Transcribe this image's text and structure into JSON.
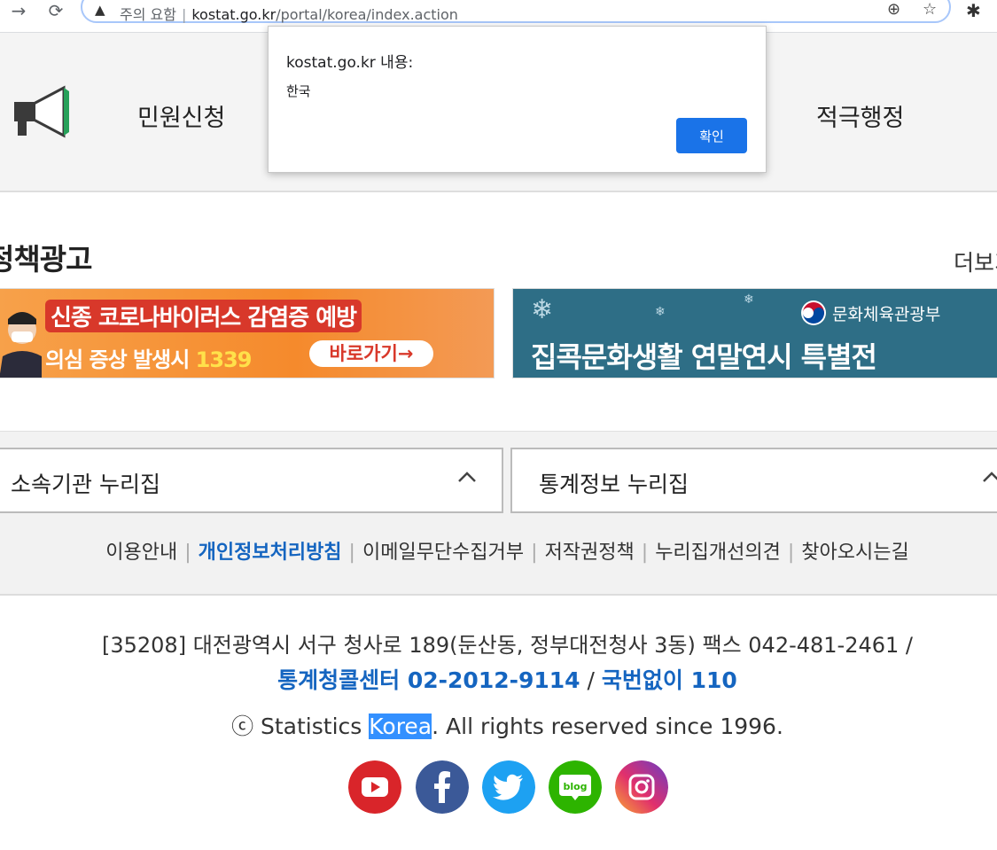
{
  "browser": {
    "security_label": "주의 요함",
    "url_host": "kostat.go.kr",
    "url_path": "/portal/korea/index.action"
  },
  "nav": {
    "items": [
      "민원신청",
      "적극행정"
    ]
  },
  "dialog": {
    "title": "kostat.go.kr 내용:",
    "message": "한국",
    "ok_label": "확인"
  },
  "policy_ads": {
    "title": "정책광고",
    "more_label": "더보기",
    "banners": [
      {
        "line1": "신종 코로나바이러스 감염증 예방",
        "line2_prefix": "의심 증상 발생시 ",
        "line2_number": "1339",
        "button": "바로가기→"
      },
      {
        "ministry": "문화체육관광부",
        "text": "집콕문화생활 연말연시 특별전"
      }
    ]
  },
  "footer": {
    "dropdowns": [
      "소속기관 누리집",
      "통계정보 누리집"
    ],
    "links": [
      "이용안내",
      "개인정보처리방침",
      "이메일무단수집거부",
      "저작권정책",
      "누리집개선의견",
      "찾아오시는길"
    ],
    "address": "[35208] 대전광역시 서구 청사로 189(둔산동, 정부대전청사 3동) 팩스 042-481-2461 /",
    "call_center": "통계청콜센터 02-2012-9114",
    "call_sep": " / ",
    "national": "국번없이 110",
    "copyright_prefix": "ⓒ Statistics ",
    "copyright_selected": "Korea",
    "copyright_suffix": ". All rights reserved since 1996.",
    "social": [
      "youtube-icon",
      "facebook-icon",
      "twitter-icon",
      "blog-icon",
      "instagram-icon"
    ],
    "blog_label": "blog"
  },
  "colors": {
    "accent_blue": "#1565c0",
    "dialog_button": "#1a73e8",
    "youtube": "#d9252a",
    "facebook": "#3b5998",
    "twitter": "#1da1f2",
    "blog": "#2db400"
  }
}
